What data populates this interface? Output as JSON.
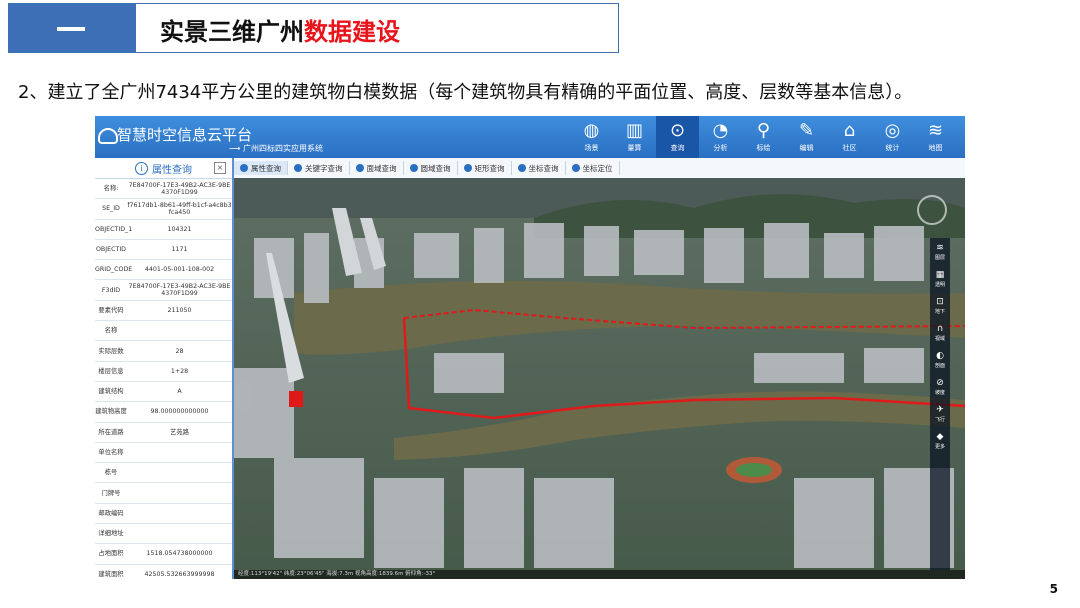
{
  "slide": {
    "section_dash": "—",
    "title_prefix": "实景三维广州",
    "title_highlight": "数据建设",
    "subtitle": "2、建立了全广州7434平方公里的建筑物白模数据（每个建筑物具有精确的平面位置、高度、层数等基本信息）。",
    "page_number": "5",
    "colors": {
      "header_blue": "#3d6fb6",
      "highlight_red": "#e8141b"
    }
  },
  "app": {
    "title": "智慧时空信息云平台",
    "subtitle": "广州四标四实应用系统",
    "tools": [
      {
        "icon": "globe-icon",
        "label": "场景"
      },
      {
        "icon": "ruler-icon",
        "label": "量算"
      },
      {
        "icon": "search-icon",
        "label": "查询"
      },
      {
        "icon": "analysis-icon",
        "label": "分析"
      },
      {
        "icon": "location-pin-icon",
        "label": "标绘"
      },
      {
        "icon": "edit-icon",
        "label": "编辑"
      },
      {
        "icon": "community-icon",
        "label": "社区"
      },
      {
        "icon": "statistics-icon",
        "label": "统计"
      },
      {
        "icon": "layers-icon",
        "label": "地图"
      }
    ],
    "active_tool": "查询"
  },
  "panel": {
    "title": "属性查询",
    "close": "×",
    "rows": [
      {
        "key": "名称:",
        "value": "7E84700F-17E3-49B2-AC3E-9BE4370F1D99"
      },
      {
        "key": "SE_ID",
        "value": "f7617db1-8b61-49ff-b1cf-a4c8b3fca450"
      },
      {
        "key": "OBJECTID_1",
        "value": "104321"
      },
      {
        "key": "OBJECTID",
        "value": "1171"
      },
      {
        "key": "GRID_CODE",
        "value": "4401-05-001-108-002"
      },
      {
        "key": "F3dID",
        "value": "7E84700F-17E3-49B2-AC3E-9BE4370F1D99"
      },
      {
        "key": "要素代码",
        "value": "211050"
      },
      {
        "key": "名称",
        "value": ""
      },
      {
        "key": "实际层数",
        "value": "28"
      },
      {
        "key": "楼层信息",
        "value": "1+28"
      },
      {
        "key": "建筑结构",
        "value": "A"
      },
      {
        "key": "建筑物高度",
        "value": "98.000000000000"
      },
      {
        "key": "所在道路",
        "value": "艺苑路"
      },
      {
        "key": "单位名称",
        "value": ""
      },
      {
        "key": "栋号",
        "value": ""
      },
      {
        "key": "门牌号",
        "value": ""
      },
      {
        "key": "邮政编码",
        "value": ""
      },
      {
        "key": "详细地址",
        "value": ""
      },
      {
        "key": "占地面积",
        "value": "1518.054738000000"
      },
      {
        "key": "建筑面积",
        "value": "42505.532663999998"
      }
    ]
  },
  "query_tabs": [
    "属性查询",
    "关键字查询",
    "面域查询",
    "圆域查询",
    "矩形查询",
    "坐标查询",
    "坐标定位"
  ],
  "map": {
    "status": "经度:113°19'42\" 纬度:23°06'45\" 海拔:7.3m 视角高度:1839.6m 俯仰角:-33°",
    "right_tools": [
      {
        "icon": "layers-icon",
        "label": "图层"
      },
      {
        "icon": "grid-icon",
        "label": "透明"
      },
      {
        "icon": "underground-icon",
        "label": "地下"
      },
      {
        "icon": "arch-icon",
        "label": "视域"
      },
      {
        "icon": "profile-icon",
        "label": "剖面"
      },
      {
        "icon": "slope-icon",
        "label": "坡度"
      },
      {
        "icon": "flight-icon",
        "label": "飞行"
      },
      {
        "icon": "layers2-icon",
        "label": "更多"
      }
    ]
  }
}
